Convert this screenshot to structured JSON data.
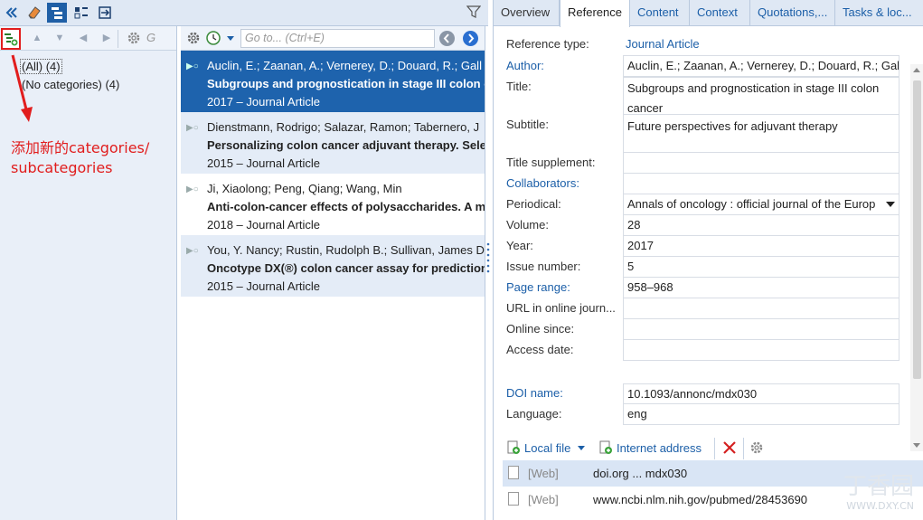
{
  "toolbar": {
    "filter_icon": "filter-icon"
  },
  "categories": {
    "all_label": "(All) (4)",
    "none_label": "(No categories) (4)",
    "search_letter": "G"
  },
  "annotation": {
    "line1": "添加新的categories/",
    "line2": "subcategories",
    "color": "#e11d1d"
  },
  "references": {
    "goto_placeholder": "Go to... (Ctrl+E)",
    "items": [
      {
        "authors": "Auclin, E.; Zaanan, A.; Vernerey, D.; Douard, R.; Gall",
        "title": "Subgroups and prognostication in stage III colon c",
        "meta": "2017 – Journal Article"
      },
      {
        "authors": "Dienstmann, Rodrigo; Salazar, Ramon; Tabernero, J",
        "title": "Personalizing colon cancer adjuvant therapy. Selec",
        "meta": "2015 – Journal Article"
      },
      {
        "authors": "Ji, Xiaolong; Peng, Qiang; Wang, Min",
        "title": "Anti-colon-cancer effects of polysaccharides. A mi",
        "meta": "2018 – Journal Article"
      },
      {
        "authors": "You, Y. Nancy; Rustin, Rudolph B.; Sullivan, James D",
        "title": "Oncotype DX(®) colon cancer assay for prediction",
        "meta": "2015 – Journal Article"
      }
    ]
  },
  "tabs": [
    "Overview",
    "Reference",
    "Content",
    "Context",
    "Quotations,...",
    "Tasks & loc..."
  ],
  "fields": {
    "reference_type_label": "Reference type:",
    "reference_type_value": "Journal Article",
    "author_label": "Author:",
    "author_value": "Auclin, E.; Zaanan, A.; Vernerey, D.; Douard, R.; Gallo",
    "title_label": "Title:",
    "title_value": "Subgroups and prognostication in stage III colon cancer",
    "subtitle_label": "Subtitle:",
    "subtitle_value": "Future perspectives for adjuvant therapy",
    "title_supplement_label": "Title supplement:",
    "collaborators_label": "Collaborators:",
    "periodical_label": "Periodical:",
    "periodical_value": "Annals of oncology : official journal of the Europ",
    "volume_label": "Volume:",
    "volume_value": "28",
    "year_label": "Year:",
    "year_value": "2017",
    "issue_label": "Issue number:",
    "issue_value": "5",
    "page_range_label": "Page range:",
    "page_range_value": "958–968",
    "url_label": "URL in online journ...",
    "online_since_label": "Online since:",
    "access_date_label": "Access date:",
    "doi_label": "DOI name:",
    "doi_value": "10.1093/annonc/mdx030",
    "language_label": "Language:",
    "language_value": "eng"
  },
  "attachments": {
    "local_file_label": "Local file",
    "internet_address_label": "Internet address",
    "items": [
      {
        "type": "[Web]",
        "url": "doi.org ... mdx030"
      },
      {
        "type": "[Web]",
        "url": "www.ncbi.nlm.nih.gov/pubmed/28453690"
      }
    ]
  },
  "watermark": {
    "text_big": "丁香园",
    "text_small": "WWW.DXY.CN"
  },
  "colors": {
    "selected_row": "#1e63ad",
    "link_blue": "#1c5fa8",
    "alt_row": "#e4ecf7"
  }
}
